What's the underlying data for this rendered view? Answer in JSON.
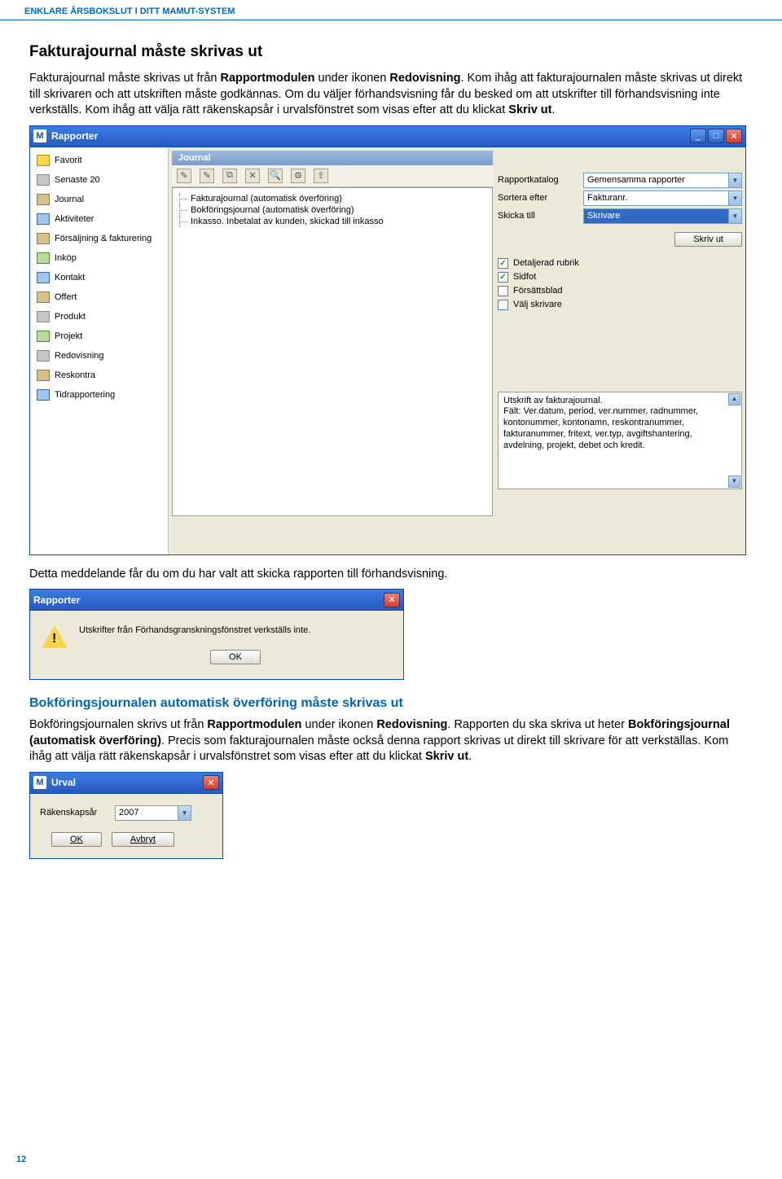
{
  "header": "ENKLARE ÅRSBOKSLUT I DITT MAMUT-SYSTEM",
  "h2": "Fakturajournal måste skrivas ut",
  "p1_a": "Fakturajournal måste skrivas ut från ",
  "p1_b": "Rapportmodulen",
  "p1_c": " under ikonen ",
  "p1_d": "Redovisning",
  "p1_e": ". Kom ihåg att fakturajournalen måste skrivas ut direkt till skrivaren och att utskriften måste godkännas. Om du väljer förhandsvisning får du besked om att utskrifter till förhandsvisning inte verkställs. Kom ihåg att välja rätt räkenskapsår i urvalsfönstret som visas efter att du klickat ",
  "p1_f": "Skriv ut",
  "p1_g": ".",
  "win1": {
    "title": "Rapporter",
    "sidebar": [
      "Favorit",
      "Senaste 20",
      "Journal",
      "Aktiviteter",
      "Försäljning & fakturering",
      "Inköp",
      "Kontakt",
      "Offert",
      "Produkt",
      "Projekt",
      "Redovisning",
      "Reskontra",
      "Tidrapportering"
    ],
    "panel_header": "Journal",
    "tree": [
      "Fakturajournal (automatisk överföring)",
      "Bokföringsjournal (automatisk överföring)",
      "Inkasso. Inbetalat av kunden, skickad till inkasso"
    ],
    "labels": {
      "rapportkatalog": "Rapportkatalog",
      "sortera": "Sortera efter",
      "skicka": "Skicka till"
    },
    "combos": {
      "rapportkatalog": "Gemensamma rapporter",
      "sortera": "Fakturanr.",
      "skicka": "Skrivare"
    },
    "skrivut": "Skriv ut",
    "checks": [
      {
        "label": "Detaljerad rubrik",
        "checked": true
      },
      {
        "label": "Sidfot",
        "checked": true
      },
      {
        "label": "Försättsblad",
        "checked": false
      },
      {
        "label": "Välj skrivare",
        "checked": false
      }
    ],
    "desc": "Utskrift av fakturajournal.\nFält: Ver.datum, period, ver.nummer, radnummer, kontonummer, kontonamn, reskontranummer, fakturanummer, fritext, ver.typ, avgiftshantering, avdelning, projekt, debet och kredit."
  },
  "p2": "Detta meddelande får du om du har valt att skicka rapporten till förhandsvisning.",
  "win2": {
    "title": "Rapporter",
    "text": "Utskrifter från Förhandsgranskningsfönstret verkställs inte.",
    "ok": "OK"
  },
  "h3": "Bokföringsjournalen automatisk överföring måste skrivas ut",
  "p3_a": "Bokföringsjournalen skrivs ut från ",
  "p3_b": "Rapportmodulen",
  "p3_c": " under ikonen ",
  "p3_d": "Redovisning",
  "p3_e": ". Rapporten du ska skriva ut heter ",
  "p3_f": "Bokföringsjournal (automatisk överföring)",
  "p3_g": ". Precis som fakturajournalen måste också denna rapport skrivas ut direkt till skrivare för att verkställas. Kom ihåg att välja rätt räkenskapsår i urvalsfönstret som visas efter att du klickat ",
  "p3_h": "Skriv ut",
  "p3_i": ".",
  "win3": {
    "title": "Urval",
    "label": "Räkenskapsår",
    "value": "2007",
    "ok": "OK",
    "cancel": "Avbryt"
  },
  "pagenum": "12"
}
